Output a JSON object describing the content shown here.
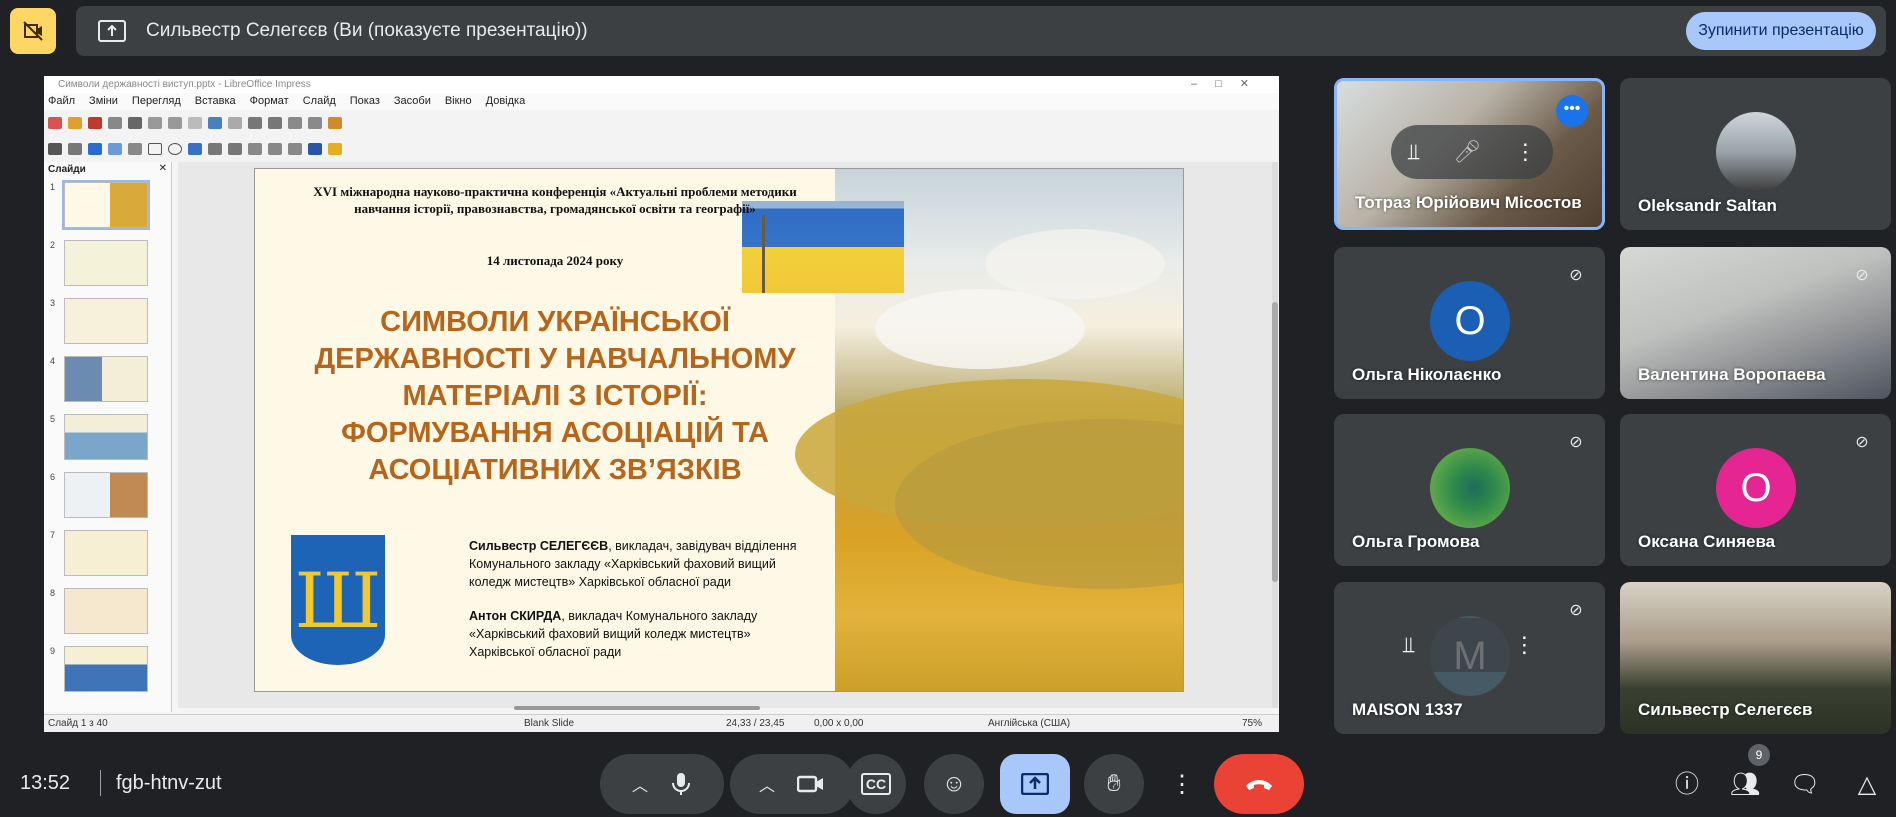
{
  "presenting_bar": {
    "title": "Сильвестр Селегєєв (Ви (показуєте презентацію))",
    "stop_button": "Зупинити презентацію"
  },
  "impress": {
    "window_title": "Символи державності виступ.pptx - LibreOffice Impress",
    "menu": [
      "Файл",
      "Зміни",
      "Перегляд",
      "Вставка",
      "Формат",
      "Слайд",
      "Показ",
      "Засоби",
      "Вікно",
      "Довідка"
    ],
    "slides_panel_title": "Слайди",
    "slide_numbers": [
      "1",
      "2",
      "3",
      "4",
      "5",
      "6",
      "7",
      "8",
      "9"
    ],
    "status": {
      "slide_pos": "Слайд 1 з 40",
      "layout": "Blank Slide",
      "coords": "24,33 / 23,45",
      "size": "0,00 x 0,00",
      "language": "Англійська (США)",
      "zoom": "75%"
    }
  },
  "slide": {
    "conference": "XVI міжнародна науково-практична конференція «Актуальні проблеми методики навчання історії, правознавства, громадянської освіти та географії»",
    "date": "14 листопада 2024 року",
    "title": "СИМВОЛИ УКРАЇНСЬКОЇ ДЕРЖАВНОСТІ У НАВЧАЛЬНОМУ МАТЕРІАЛІ З ІСТОРІЇ: ФОРМУВАННЯ АСОЦІАЦІЙ ТА АСОЦІАТИВНИХ ЗВ’ЯЗКІВ",
    "author1_name": "Сильвестр СЕЛЕГЄЄВ",
    "author1_rest": ", викладач, завідувач відділення Комунального закладу «Харківський фаховий вищий коледж мистецтв» Харківської обласної ради",
    "author2_name": "Антон СКИРДА",
    "author2_rest": ", викладач Комунального закладу «Харківський фаховий вищий коледж мистецтв» Харківської обласної ради"
  },
  "participants": [
    {
      "name": "Тотраз Юрійович Місостов"
    },
    {
      "name": "Oleksandr Saltan"
    },
    {
      "name": "Ольга Ніколаєнко",
      "initial": "О"
    },
    {
      "name": "Валентина Воропаева"
    },
    {
      "name": "Ольга Громова"
    },
    {
      "name": "Оксана Синяева",
      "initial": "О"
    },
    {
      "name": "MAISON 1337",
      "initial": "M"
    },
    {
      "name": "Сильвестр Селегєєв"
    }
  ],
  "bottom_bar": {
    "time": "13:52",
    "meeting_code": "fgb-htnv-zut",
    "people_count": "9"
  },
  "colors": {
    "accent": "#8ab4f8",
    "present_active": "#a8c7fa",
    "end_call": "#ea4335",
    "camera_off": "#fdd663",
    "slide_title": "#b7651a"
  }
}
